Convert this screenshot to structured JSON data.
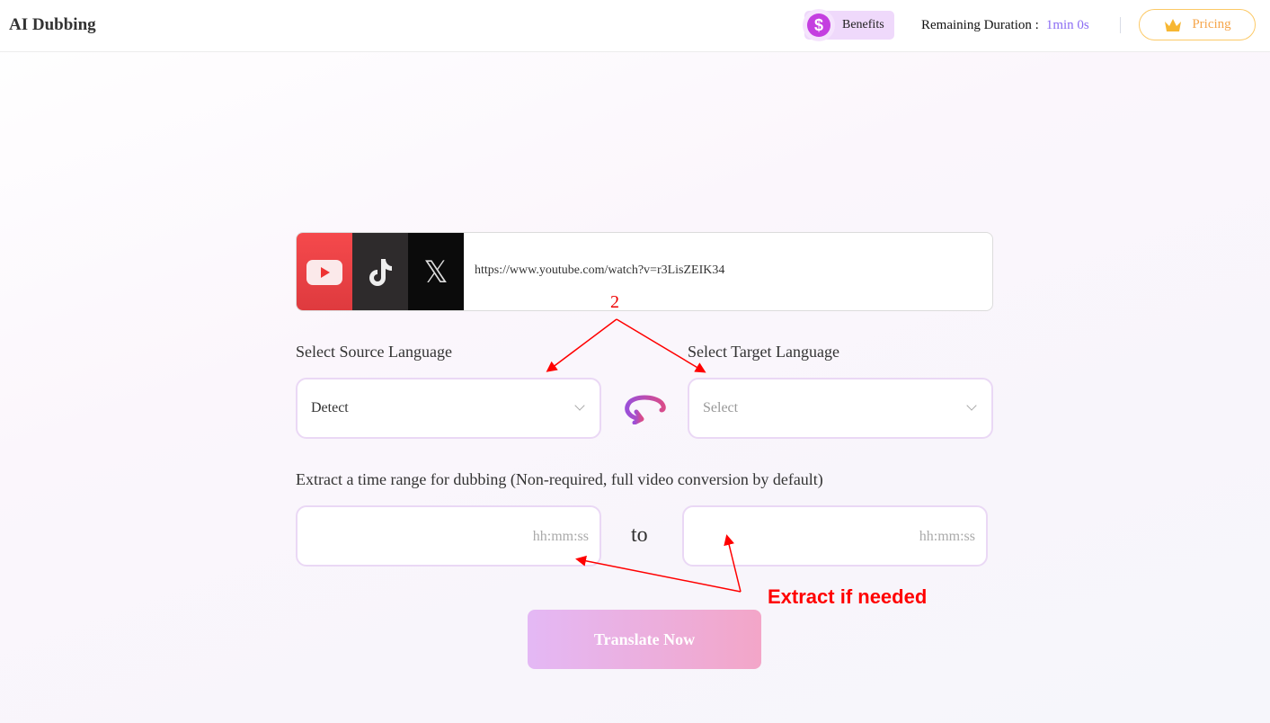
{
  "header": {
    "title": "AI Dubbing",
    "benefits_label": "Benefits",
    "benefits_icon": "dollar-coin-icon",
    "remaining_label": "Remaining Duration :",
    "remaining_value": "1min 0s",
    "pricing_label": "Pricing",
    "pricing_icon": "crown-icon"
  },
  "url_input": {
    "value": "https://www.youtube.com/watch?v=r3LisZEIK34",
    "platforms": [
      "youtube-icon",
      "tiktok-icon",
      "x-icon"
    ]
  },
  "source": {
    "label": "Select Source Language",
    "value": "Detect"
  },
  "target": {
    "label": "Select Target Language",
    "placeholder": "Select"
  },
  "time_range": {
    "label": "Extract a time range for dubbing (Non-required, full video conversion by default)",
    "start_placeholder": "hh:mm:ss",
    "to": "to",
    "end_placeholder": "hh:mm:ss"
  },
  "translate_button": "Translate Now",
  "annotations": {
    "number": "2",
    "note": "Extract if needed",
    "color": "#ff0000"
  },
  "colors": {
    "accent": "#8b6cf3",
    "pricing": "#f6a64c",
    "button_start": "#e4b8f5",
    "button_end": "#f3a6c8"
  }
}
